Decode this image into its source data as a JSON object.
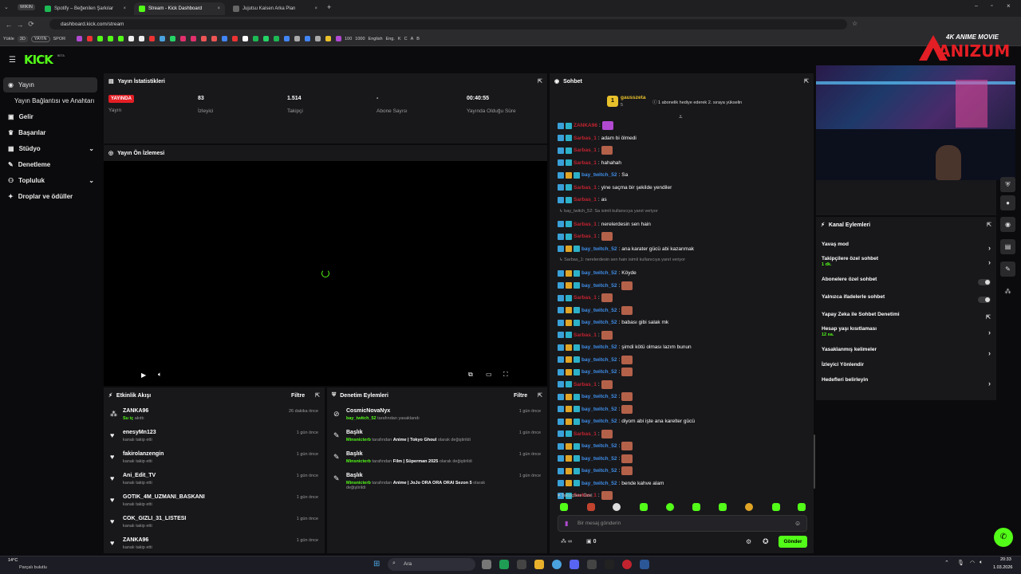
{
  "browser": {
    "tabs": [
      {
        "label": "WIKIN",
        "kind": "group"
      },
      {
        "label": "Spotify – Beğenilen Şarkılar"
      },
      {
        "label": "Stream - Kick Dashboard",
        "active": true
      },
      {
        "label": "Jujutsu Kaisen Arka Plan"
      }
    ],
    "url": "dashboard.kick.com/stream",
    "bookmarks": [
      "Yükle",
      "3D",
      "YAYIN",
      "SPOR",
      "IP",
      "Ö",
      "100",
      "1000",
      "English",
      "Eng.",
      "K",
      "C",
      "A",
      "B",
      "H",
      "P"
    ]
  },
  "watermark": {
    "tag": "4K ANIME MOVIE",
    "name": "ANIZUM"
  },
  "kick": {
    "logo": "KICK",
    "beta": "BETA"
  },
  "sidebar": {
    "items": [
      {
        "label": "Yayın",
        "icon": "broadcast-icon",
        "selected": true
      },
      {
        "label": "Yayın Bağlantısı ve Anahtarı",
        "icon": ""
      },
      {
        "label": "Gelir",
        "icon": "money-icon"
      },
      {
        "label": "Başarılar",
        "icon": "trophy-icon"
      },
      {
        "label": "Stüdyo",
        "icon": "studio-icon",
        "chevron": true
      },
      {
        "label": "Denetleme",
        "icon": "wrench-icon"
      },
      {
        "label": "Topluluk",
        "icon": "community-icon",
        "chevron": true
      },
      {
        "label": "Droplar ve ödüller",
        "icon": "gift-icon"
      }
    ]
  },
  "stats": {
    "title": "Yayın İstatistikleri",
    "cols": [
      {
        "value": "YAYINDA",
        "label": "Yayın"
      },
      {
        "value": "83",
        "label": "İzleyici"
      },
      {
        "value": "1.514",
        "label": "Takipçi"
      },
      {
        "value": "-",
        "label": "Abone Sayısı"
      },
      {
        "value": "00:40:55",
        "label": "Yayında Olduğu Süre"
      }
    ]
  },
  "preview": {
    "title": "Yayın Ön İzlemesi"
  },
  "activity": {
    "title": "Etkinlik Akışı",
    "filter": "Filtre",
    "rows": [
      {
        "name": "ZANKA96",
        "sub": "Su iç",
        "sub2": "akıttı",
        "time": "26 dakika önce",
        "icon": "drop-icon"
      },
      {
        "name": "enesyMn123",
        "sub": "kanalı takip etti",
        "time": "1 gün önce",
        "icon": "heart-icon"
      },
      {
        "name": "fakirolanzengin",
        "sub": "kanalı takip etti",
        "time": "1 gün önce",
        "icon": "heart-icon"
      },
      {
        "name": "Ani_Edit_TV",
        "sub": "kanalı takip etti",
        "time": "1 gün önce",
        "icon": "heart-icon"
      },
      {
        "name": "GOTIK_4M_UZMANI_BASKANI",
        "sub": "kanalı takip etti",
        "time": "1 gün önce",
        "icon": "heart-icon"
      },
      {
        "name": "COK_GIZLI_31_LISTESI",
        "sub": "kanalı takip etti",
        "time": "1 gün önce",
        "icon": "heart-icon"
      },
      {
        "name": "ZANKA96",
        "sub": "kanalı takip etti",
        "time": "1 gün önce",
        "icon": "heart-icon"
      }
    ]
  },
  "moderation": {
    "title": "Denetim Eylemleri",
    "filter": "Filtre",
    "rows": [
      {
        "name": "CosmicNovaNyx",
        "actor": "bay_twitch_52",
        "sub": "tarafından yasaklandı",
        "time": "1 gün önce"
      },
      {
        "name": "Başlık",
        "actor": "Minsnicterb",
        "sub": "tarafından",
        "detail": "Anime | Tokyo Ghoul",
        "tail": "olarak değiştirildi",
        "time": "1 gün önce"
      },
      {
        "name": "Başlık",
        "actor": "Minsnicterb",
        "sub": "tarafından",
        "detail": "Film | Süperman 2025",
        "tail": "olarak değiştirildi",
        "time": "1 gün önce"
      },
      {
        "name": "Başlık",
        "actor": "Minsnicterb",
        "sub": "tarafından",
        "detail": "Anime | JoJo",
        "detail2": "ORA ORA ORAI Sezon 5",
        "tail": "olarak",
        "tail2": "değiştirildi",
        "time": "1 gün önce"
      }
    ]
  },
  "chat": {
    "title": "Sohbet",
    "pinned": {
      "user": "gausszeta",
      "count": "5",
      "rank": "1",
      "note": "1 abonelik hediye ederek 2. sıraya yükselin"
    },
    "messages": [
      {
        "user": "ZANKA96",
        "color": "red",
        "text": "",
        "emote": true
      },
      {
        "user": "Sarbas_1",
        "color": "red",
        "text": "adam bi ölmedi"
      },
      {
        "user": "Sarbas_1",
        "color": "red",
        "text": "",
        "emote": true
      },
      {
        "user": "Sarbas_1",
        "color": "red",
        "text": "hahahah"
      },
      {
        "user": "bay_twitch_52",
        "color": "blue",
        "text": "Sa"
      },
      {
        "user": "Sarbas_1",
        "color": "red",
        "text": "yine saçma bir şekilde yendiler"
      },
      {
        "user": "Sarbas_1",
        "color": "red",
        "text": "as"
      },
      {
        "reply": "bay_twitch_52: Sa isimli kullanıcıya yanıt veriyor"
      },
      {
        "user": "Sarbas_1",
        "color": "red",
        "text": "nerelerdesin sen hain"
      },
      {
        "user": "Sarbas_1",
        "color": "red",
        "text": "",
        "emote": true
      },
      {
        "user": "bay_twitch_52",
        "color": "blue",
        "text": "ana karater gücü abi kazanmak"
      },
      {
        "reply": "Sarbas_1: nerelerdesin sen hain isimli kullanıcıya yanıt veriyor"
      },
      {
        "user": "bay_twitch_52",
        "color": "blue",
        "text": "Köyde"
      },
      {
        "user": "bay_twitch_52",
        "color": "blue",
        "text": "",
        "emote": true
      },
      {
        "user": "Sarbas_1",
        "color": "red",
        "text": "",
        "emote": true
      },
      {
        "user": "bay_twitch_52",
        "color": "blue",
        "text": "",
        "emote": true
      },
      {
        "user": "bay_twitch_52",
        "color": "blue",
        "text": "babası gibi salak mk"
      },
      {
        "user": "Sarbas_1",
        "color": "red",
        "text": "",
        "emote": true
      },
      {
        "user": "bay_twitch_52",
        "color": "blue",
        "text": "şimdi kötü olması lazım bunun"
      },
      {
        "user": "bay_twitch_52",
        "color": "blue",
        "text": "",
        "emote": true
      },
      {
        "user": "bay_twitch_52",
        "color": "blue",
        "text": "",
        "emote": true
      },
      {
        "user": "Sarbas_1",
        "color": "red",
        "text": "",
        "emote": true
      },
      {
        "user": "bay_twitch_52",
        "color": "blue",
        "text": "",
        "emote": true
      },
      {
        "user": "bay_twitch_52",
        "color": "blue",
        "text": "",
        "emote": true
      },
      {
        "user": "bay_twitch_52",
        "color": "blue",
        "text": "diyom abi işte ana karelter gücü"
      },
      {
        "user": "Sarbas_1",
        "color": "red",
        "text": "",
        "emote": true
      },
      {
        "user": "bay_twitch_52",
        "color": "blue",
        "text": "",
        "emote": true
      },
      {
        "user": "bay_twitch_52",
        "color": "blue",
        "text": "",
        "emote": true
      },
      {
        "user": "bay_twitch_52",
        "color": "blue",
        "text": "",
        "emote": true
      },
      {
        "user": "bay_twitch_52",
        "color": "blue",
        "text": "bende kahve alam"
      },
      {
        "user": "Sarbas_1",
        "color": "red",
        "text": "",
        "emote": true
      }
    ],
    "followers_only": "Takipçilere Özel",
    "placeholder": "Bir mesaj gönderin",
    "infinity": "∞",
    "count": "0",
    "send": "Gönder"
  },
  "channel": {
    "title": "Kanal Eylemleri",
    "rows": [
      {
        "label": "Yavaş mod",
        "type": "chevron"
      },
      {
        "label": "Takipçilere özel sohbet",
        "sub": "1 dk.",
        "type": "chevron"
      },
      {
        "label": "Abonelere özel sohbet",
        "type": "toggle"
      },
      {
        "label": "Yalnızca ifadelerle sohbet",
        "type": "toggle"
      },
      {
        "label": "Yapay Zeka ile Sohbet Denetimi",
        "type": "link"
      },
      {
        "label": "Hesap yaşı kısıtlaması",
        "sub": "12 sa.",
        "type": "chevron"
      },
      {
        "label": "Yasaklanmış kelimeler",
        "type": "chevron"
      },
      {
        "label": "İzleyici Yönlendir",
        "type": "none"
      },
      {
        "label": "Hedefleri belirleyin",
        "type": "chevron"
      }
    ]
  },
  "taskbar": {
    "weather_temp": "14°C",
    "weather_desc": "Parçalı bulutlu",
    "search": "Ara",
    "time": "20:33",
    "date": "1.03.2026"
  },
  "colors": {
    "accent": "#53fc18",
    "live": "#e31e24",
    "panel": "#18181b",
    "bg": "#0b0b0d"
  }
}
